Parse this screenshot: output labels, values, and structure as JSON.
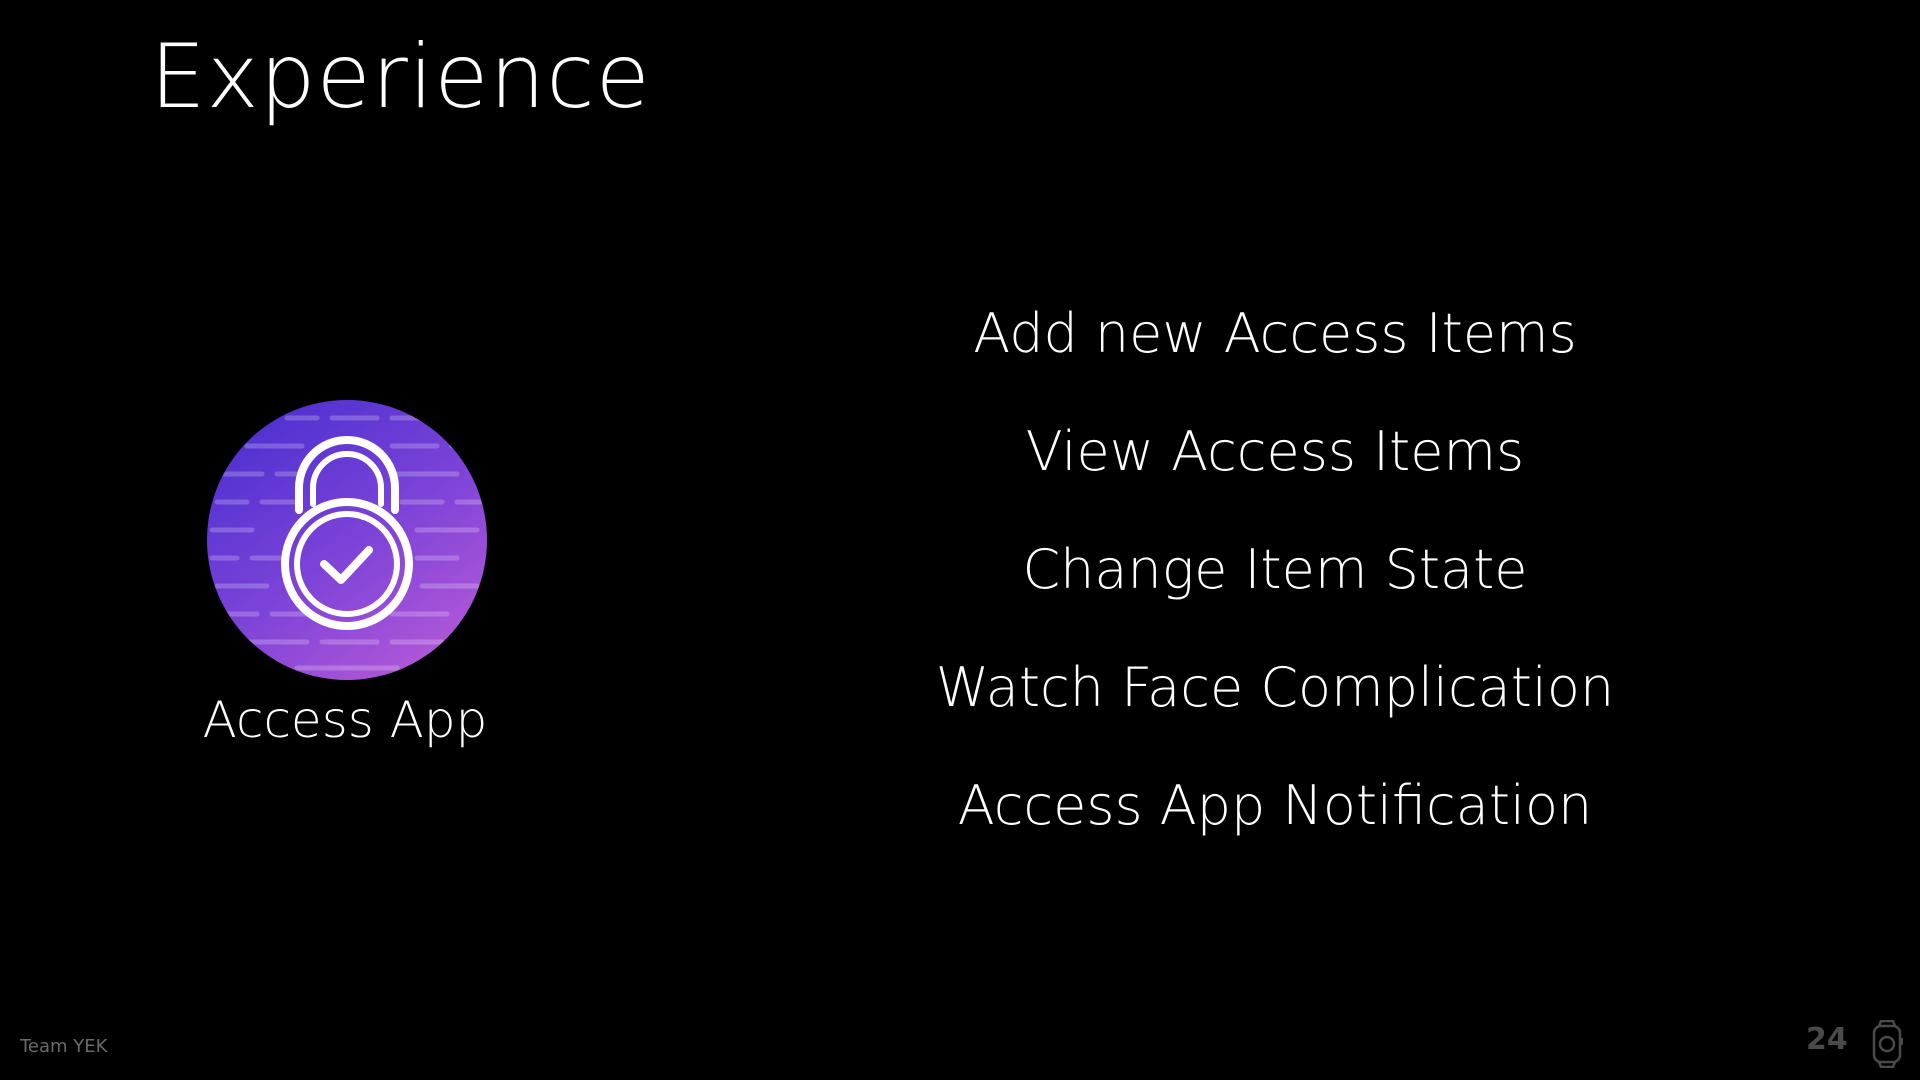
{
  "slide": {
    "title": "Experience",
    "app": {
      "label": "Access App",
      "icon": "lock-check-icon",
      "gradient_top": "#4b2fcf",
      "gradient_bottom": "#b457d6"
    },
    "features": [
      "Add new Access Items",
      "View Access Items",
      "Change Item State",
      "Watch Face Complication",
      "Access App Notification"
    ],
    "footer": {
      "team": "Team YEK",
      "page_number": "24",
      "icon": "apple-watch-icon"
    }
  }
}
